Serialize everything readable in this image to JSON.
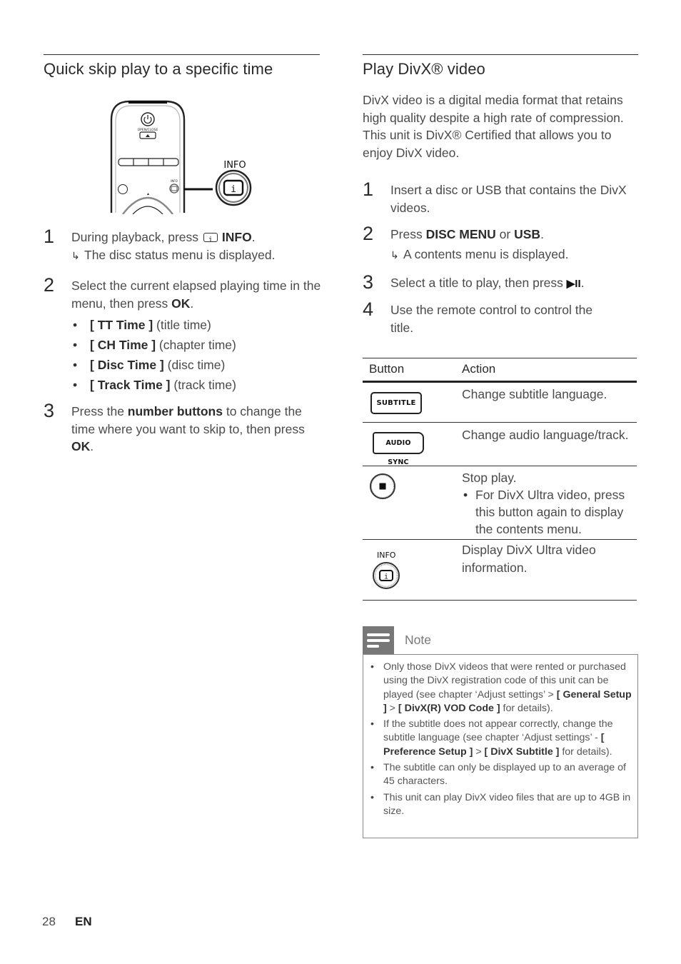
{
  "left": {
    "title": "Quick skip play to a specific time",
    "remote_labels": {
      "open_close": "OPEN/CLOSE",
      "info_small": "INFO",
      "info_callout": "INFO"
    },
    "steps": [
      {
        "number": "1",
        "text_before": "During playback, press ",
        "icon": "info-icon",
        "key": "INFO",
        "text_after": ".",
        "result": "The disc status menu is displayed."
      },
      {
        "number": "2",
        "text_before": "Select the current elapsed playing time in the menu, then press ",
        "key": "OK",
        "text_after": ".",
        "bullets": [
          {
            "label": "[ TT Time ]",
            "desc": "(title time)"
          },
          {
            "label": "[ CH Time ]",
            "desc": "(chapter time)"
          },
          {
            "label": "[ Disc Time ]",
            "desc": "(disc time)"
          },
          {
            "label": "[ Track Time ]",
            "desc": "(track time)"
          }
        ]
      },
      {
        "number": "3",
        "text_before": "Press the ",
        "key": "number buttons",
        "text_mid": " to change the time where you want to skip to, then press ",
        "key2": "OK",
        "text_after": "."
      }
    ]
  },
  "right": {
    "title": "Play DivX® video",
    "intro": "DivX video is a digital media format that retains high quality despite a high rate of compression. This unit is DivX® Certified that allows you to enjoy DivX video.",
    "steps": [
      {
        "number": "1",
        "text": "Insert a disc or USB that contains the DivX videos."
      },
      {
        "number": "2",
        "text_before": "Press ",
        "key": "DISC MENU",
        "text_mid": " or ",
        "key2": "USB",
        "text_after": ".",
        "result": "A contents menu is displayed."
      },
      {
        "number": "3",
        "text_before": "Select a title to play, then press ",
        "key": "▶II",
        "text_after": "."
      },
      {
        "number": "4",
        "text": "Use the remote control to control the title."
      }
    ],
    "table": {
      "headers": [
        "Button",
        "Action"
      ],
      "rows": [
        {
          "button": "SUBTITLE",
          "button_icon": "subtitle-button-icon",
          "action": "Change subtitle language."
        },
        {
          "button": "AUDIO SYNC",
          "button_icon": "audio-sync-button-icon",
          "action": "Change audio language/track."
        },
        {
          "button": "",
          "button_icon": "stop-button-icon",
          "action": "Stop play.",
          "bullet": "For DivX Ultra video, press this button again to display the contents menu."
        },
        {
          "button": "INFO",
          "button_icon": "info-button-icon",
          "action": "Display DivX Ultra video information."
        }
      ]
    },
    "note": {
      "title": "Note",
      "items": [
        {
          "parts": [
            {
              "t": "Only those DivX videos that were rented or purchased using the DivX registration code of this unit can be played (see chapter ‘Adjust settings’ > "
            },
            {
              "t": "[ General Setup ]",
              "b": true
            },
            {
              "t": " > "
            },
            {
              "t": "[ DivX(R) VOD Code ]",
              "b": true
            },
            {
              "t": " for details)."
            }
          ]
        },
        {
          "parts": [
            {
              "t": "If the subtitle does not appear correctly, change the subtitle language (see chapter ‘Adjust settings’ - "
            },
            {
              "t": "[ Preference Setup ]",
              "b": true
            },
            {
              "t": " > "
            },
            {
              "t": "[ DivX Subtitle ]",
              "b": true
            },
            {
              "t": " for details)."
            }
          ]
        },
        {
          "parts": [
            {
              "t": "The subtitle can only be displayed up to an average of 45 characters."
            }
          ]
        },
        {
          "parts": [
            {
              "t": "This unit can play DivX video files that are up to 4GB in size."
            }
          ]
        }
      ]
    }
  },
  "footer": {
    "page_number": "28",
    "language": "EN"
  }
}
